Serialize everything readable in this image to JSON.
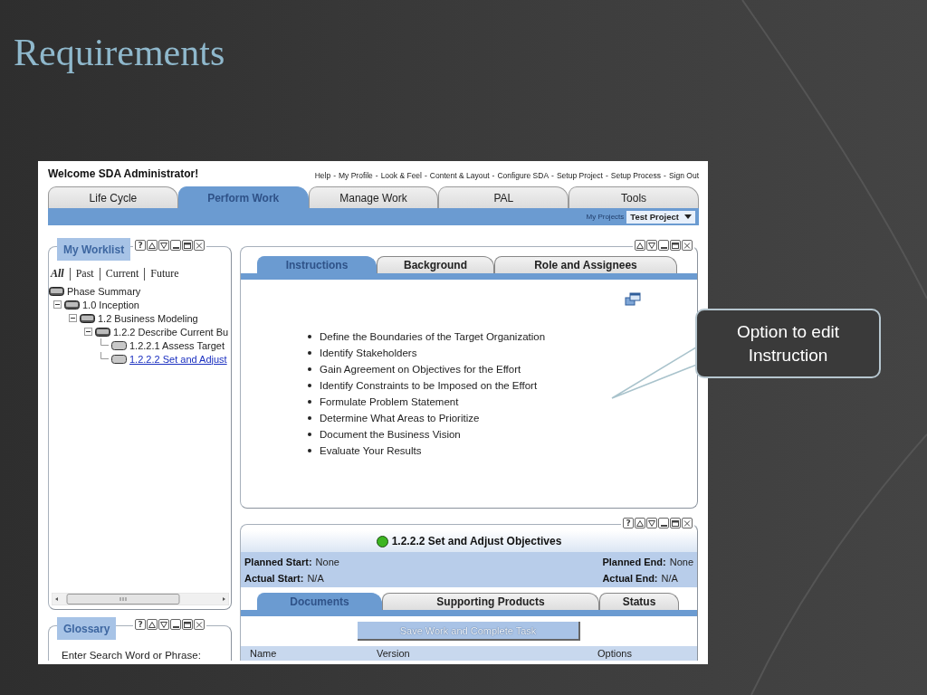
{
  "slide": {
    "title": "Requirements",
    "callout": "Option to edit Instruction"
  },
  "app": {
    "welcome": "Welcome SDA Administrator!",
    "link_separator": "-",
    "links": [
      {
        "label": "Help"
      },
      {
        "label": "My Profile"
      },
      {
        "label": "Look & Feel"
      },
      {
        "label": "Content & Layout"
      },
      {
        "label": "Configure SDA"
      },
      {
        "label": "Setup Project"
      },
      {
        "label": "Setup Process"
      },
      {
        "label": "Sign Out"
      }
    ],
    "tabs": [
      {
        "label": "Life Cycle",
        "selected": false
      },
      {
        "label": "Perform Work",
        "selected": true
      },
      {
        "label": "Manage Work",
        "selected": false
      },
      {
        "label": "PAL",
        "selected": false
      },
      {
        "label": "Tools",
        "selected": false
      }
    ],
    "project": {
      "label": "My Projects",
      "value": "Test Project"
    },
    "worklist": {
      "title": "My Worklist",
      "controls": [
        {
          "kind": "help",
          "glyph": "?"
        },
        {
          "kind": "up"
        },
        {
          "kind": "down"
        },
        {
          "kind": "minimize"
        },
        {
          "kind": "maximize"
        },
        {
          "kind": "close"
        }
      ],
      "filters": [
        {
          "label": "All",
          "selected": true
        },
        {
          "label": "Past",
          "selected": false
        },
        {
          "label": "Current",
          "selected": false
        },
        {
          "label": "Future",
          "selected": false
        }
      ],
      "tree": [
        {
          "label": "Phase Summary",
          "kind": "summary",
          "selected": false
        },
        {
          "label": "1.0 Inception",
          "kind": "phase",
          "selected": false,
          "expanded": true,
          "children": [
            {
              "label": "1.2 Business Modeling",
              "kind": "phase",
              "selected": false,
              "expanded": true,
              "children": [
                {
                  "label": "1.2.2 Describe Current Bu",
                  "kind": "phase",
                  "selected": false,
                  "expanded": true,
                  "children": [
                    {
                      "label": "1.2.2.1 Assess Target",
                      "kind": "task",
                      "selected": false
                    },
                    {
                      "label": "1.2.2.2 Set and Adjust",
                      "kind": "task",
                      "selected": true
                    }
                  ]
                }
              ]
            }
          ]
        }
      ]
    },
    "glossary": {
      "title": "Glossary",
      "controls": [
        {
          "kind": "help",
          "glyph": "?"
        },
        {
          "kind": "up"
        },
        {
          "kind": "down"
        },
        {
          "kind": "minimize"
        },
        {
          "kind": "maximize"
        },
        {
          "kind": "close"
        }
      ],
      "prompt": "Enter Search Word or Phrase:"
    },
    "instructions": {
      "controls": [
        {
          "kind": "up"
        },
        {
          "kind": "down"
        },
        {
          "kind": "minimize"
        },
        {
          "kind": "maximize"
        },
        {
          "kind": "close"
        }
      ],
      "tabs": [
        {
          "label": "Instructions",
          "selected": true
        },
        {
          "label": "Background",
          "selected": false
        },
        {
          "label": "Role and Assignees",
          "selected": false
        }
      ],
      "items": [
        "Define the Boundaries of the Target Organization",
        "Identify Stakeholders",
        "Gain Agreement on Objectives for the Effort",
        "Identify Constraints to be Imposed on the Effort",
        "Formulate Problem Statement",
        "Determine What Areas to Prioritize",
        "Document the Business Vision",
        "Evaluate Your Results"
      ]
    },
    "task": {
      "controls": [
        {
          "kind": "help",
          "glyph": "?"
        },
        {
          "kind": "up"
        },
        {
          "kind": "down"
        },
        {
          "kind": "minimize"
        },
        {
          "kind": "maximize"
        },
        {
          "kind": "close"
        }
      ],
      "color": "#3cb521",
      "title": "1.2.2.2 Set and Adjust Objectives",
      "fields": [
        {
          "label": "Planned Start:",
          "value": "None"
        },
        {
          "label": "Planned End:",
          "value": "None"
        },
        {
          "label": "Actual Start:",
          "value": "N/A"
        },
        {
          "label": "Actual End:",
          "value": "N/A"
        }
      ],
      "tabs": [
        {
          "label": "Documents",
          "selected": true
        },
        {
          "label": "Supporting Products",
          "selected": false
        },
        {
          "label": "Status",
          "selected": false
        }
      ],
      "button": {
        "label": "Save Work and Complete Task",
        "disabled": true
      },
      "columns": [
        "Name",
        "Version",
        "Options"
      ]
    }
  }
}
